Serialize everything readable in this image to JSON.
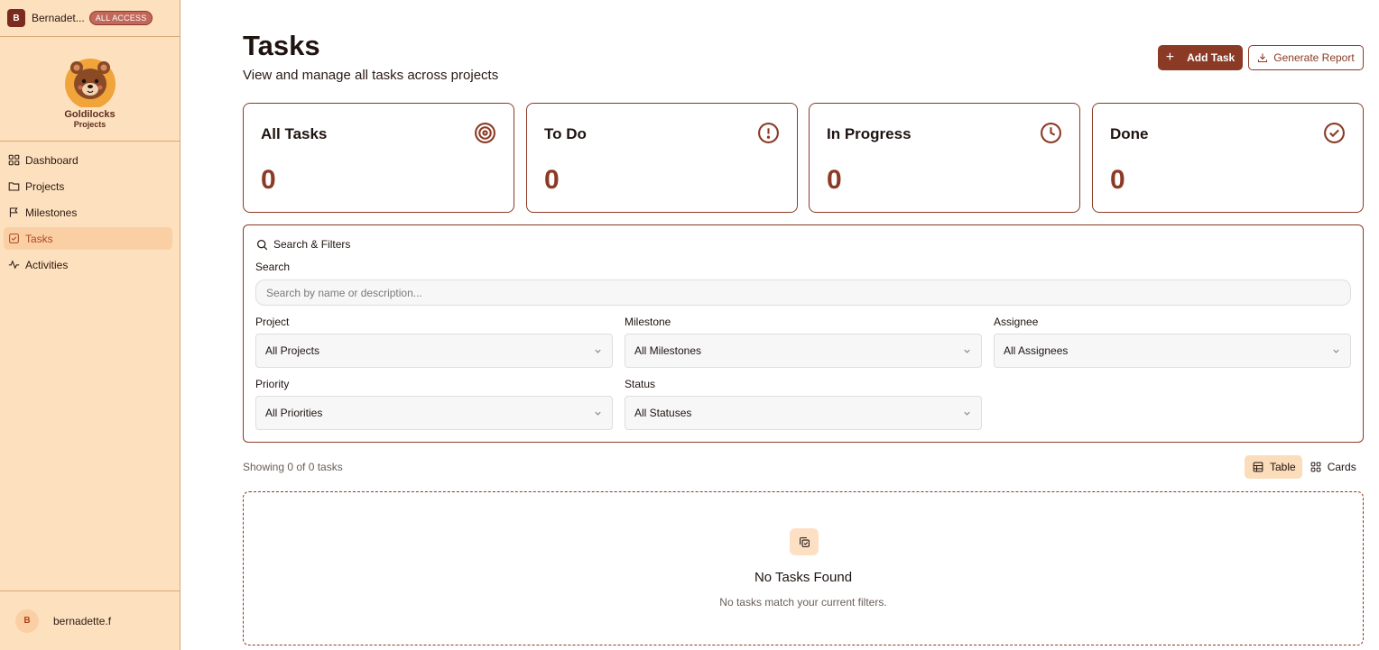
{
  "sidebar": {
    "user_initial": "B",
    "user_name": "Bernadet...",
    "access_badge": "ALL ACCESS",
    "logo": {
      "line1": "Goldilocks",
      "line2": "Projects"
    },
    "nav": [
      {
        "label": "Dashboard",
        "icon": "layout-grid-icon"
      },
      {
        "label": "Projects",
        "icon": "folder-icon"
      },
      {
        "label": "Milestones",
        "icon": "flag-icon"
      },
      {
        "label": "Tasks",
        "icon": "square-check-icon",
        "active": true
      },
      {
        "label": "Activities",
        "icon": "activity-icon"
      }
    ],
    "footer_initial": "B",
    "footer_name": "bernadette.f"
  },
  "header": {
    "title": "Tasks",
    "subtitle": "View and manage all tasks across projects",
    "add_label": "Add Task",
    "report_label": "Generate Report"
  },
  "stats": [
    {
      "label": "All Tasks",
      "value": "0",
      "icon": "target-icon"
    },
    {
      "label": "To Do",
      "value": "0",
      "icon": "alert-circle-icon"
    },
    {
      "label": "In Progress",
      "value": "0",
      "icon": "clock-icon"
    },
    {
      "label": "Done",
      "value": "0",
      "icon": "check-circle-icon"
    }
  ],
  "filters": {
    "heading": "Search & Filters",
    "search_label": "Search",
    "search_placeholder": "Search by name or description...",
    "project_label": "Project",
    "project_value": "All Projects",
    "milestone_label": "Milestone",
    "milestone_value": "All Milestones",
    "assignee_label": "Assignee",
    "assignee_value": "All Assignees",
    "priority_label": "Priority",
    "priority_value": "All Priorities",
    "status_label": "Status",
    "status_value": "All Statuses"
  },
  "results": {
    "showing": "Showing 0 of 0 tasks",
    "view_table": "Table",
    "view_cards": "Cards"
  },
  "empty": {
    "title": "No Tasks Found",
    "subtitle": "No tasks match your current filters."
  },
  "colors": {
    "accent": "#8b3a25",
    "sidebar_bg": "#fde0bd",
    "active_nav_bg": "#fbcfa4"
  }
}
